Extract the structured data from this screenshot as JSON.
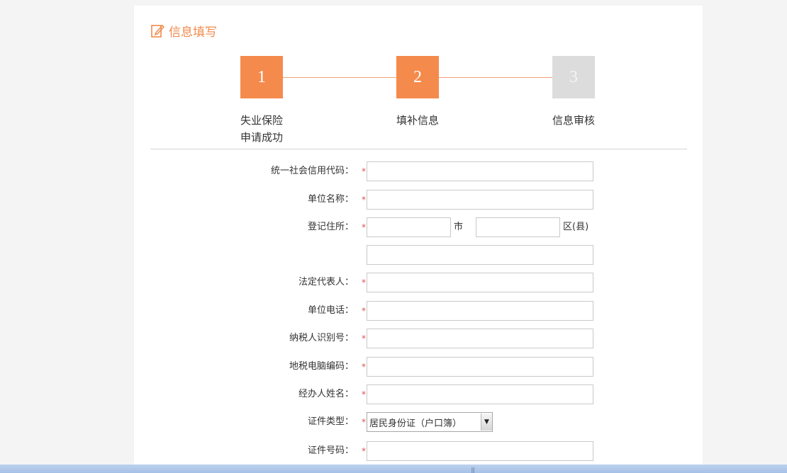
{
  "panel": {
    "title": "信息填写",
    "title_icon": "edit-form-icon"
  },
  "steps": [
    {
      "number": "1",
      "label_lines": [
        "失业保险",
        "申请成功"
      ],
      "state": "done"
    },
    {
      "number": "2",
      "label_lines": [
        "填补信息"
      ],
      "state": "current"
    },
    {
      "number": "3",
      "label_lines": [
        "信息审核"
      ],
      "state": "pending"
    }
  ],
  "form": {
    "credit_code": {
      "label": "统一社会信用代码：",
      "required": "*",
      "value": ""
    },
    "unit_name": {
      "label": "单位名称：",
      "required": "*",
      "value": ""
    },
    "address": {
      "label": "登记住所：",
      "required": "*",
      "city_value": "",
      "city_unit": "市",
      "district_value": "",
      "district_unit": "区(县)",
      "detail_value": ""
    },
    "legal_rep": {
      "label": "法定代表人：",
      "required": "*",
      "value": ""
    },
    "unit_phone": {
      "label": "单位电话：",
      "required": "*",
      "value": ""
    },
    "taxpayer_id": {
      "label": "纳税人识别号：",
      "required": "*",
      "value": ""
    },
    "local_tax_code": {
      "label": "地税电脑编码：",
      "required": "*",
      "value": ""
    },
    "handler_name": {
      "label": "经办人姓名：",
      "required": "*",
      "value": ""
    },
    "id_type": {
      "label": "证件类型：",
      "required": "*",
      "selected": "居民身份证（户口簿）"
    },
    "id_number": {
      "label": "证件号码：",
      "required": "*",
      "value": ""
    }
  },
  "colors": {
    "accent": "#f58a4d",
    "step_pending": "#dcdcdc",
    "required_mark": "#d9534f"
  }
}
